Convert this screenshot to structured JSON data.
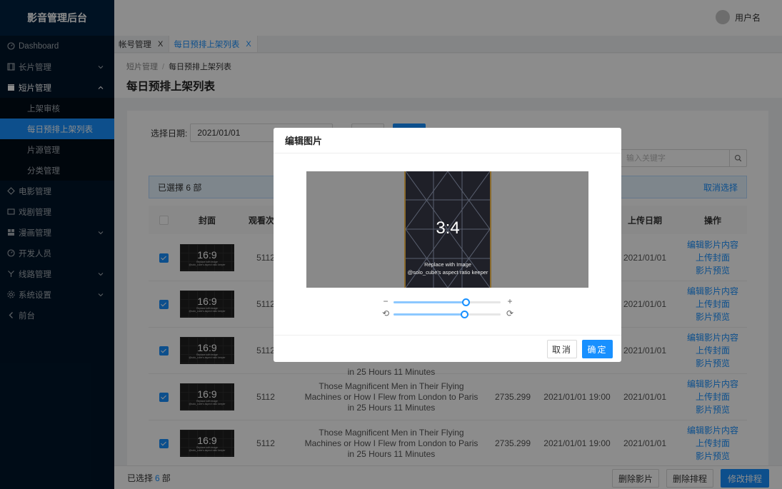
{
  "app": {
    "title": "影音管理后台"
  },
  "header": {
    "user_name": "用户名"
  },
  "sidebar": {
    "items": [
      {
        "label": "Dashboard",
        "icon": "dashboard-icon"
      },
      {
        "label": "长片管理",
        "icon": "film-icon"
      },
      {
        "label": "短片管理",
        "icon": "clapper-icon"
      },
      {
        "label": "电影管理",
        "icon": "movie-icon"
      },
      {
        "label": "戏剧管理",
        "icon": "tv-icon"
      },
      {
        "label": "漫画管理",
        "icon": "comic-icon"
      },
      {
        "label": "开发人员",
        "icon": "developer-icon"
      },
      {
        "label": "线路管理",
        "icon": "route-icon"
      },
      {
        "label": "系统设置",
        "icon": "settings-icon"
      },
      {
        "label": "前台",
        "icon": "back-icon"
      }
    ],
    "sub_items": [
      "上架审核",
      "每日预排上架列表",
      "片源管理",
      "分类管理"
    ]
  },
  "tabs": [
    {
      "label": "帐号管理",
      "close": "X"
    },
    {
      "label": "每日预排上架列表",
      "close": "X"
    }
  ],
  "breadcrumb": {
    "parent": "短片管理",
    "separator": "/",
    "current": "每日预排上架列表"
  },
  "page": {
    "title": "每日预排上架列表"
  },
  "filter": {
    "date_label": "选择日期:",
    "date_value": "2021/01/01"
  },
  "search": {
    "placeholder": "输入关键字"
  },
  "selection": {
    "text": "已選擇 6 部",
    "cancel": "取消选择"
  },
  "table": {
    "headers": {
      "cover": "封面",
      "views": "观看次数",
      "upload_date": "上传日期",
      "actions": "操作"
    },
    "rows": [
      {
        "checked": true,
        "views": "5112",
        "title": "",
        "duration": "",
        "schedule": "",
        "upload_date": "2021/01/01"
      },
      {
        "checked": true,
        "views": "5112",
        "title": "",
        "duration": "",
        "schedule": "",
        "upload_date": "2021/01/01"
      },
      {
        "checked": true,
        "views": "5112",
        "title": "in 25 Hours 11 Minutes",
        "duration": "",
        "schedule": "",
        "upload_date": "2021/01/01"
      },
      {
        "checked": true,
        "views": "5112",
        "title_lines": [
          "Those Magnificent Men in Their Flying",
          "Machines or How I Flew from London to Paris",
          "in 25 Hours 11 Minutes"
        ],
        "duration": "2735.299",
        "schedule": "2021/01/01 19:00",
        "upload_date": "2021/01/01"
      },
      {
        "checked": true,
        "views": "5112",
        "title_lines": [
          "Those Magnificent Men in Their Flying",
          "Machines or How I Flew from London to Paris",
          "in 25 Hours 11 Minutes"
        ],
        "duration": "2735.299",
        "schedule": "2021/01/01 19:00",
        "upload_date": "2021/01/01"
      }
    ],
    "thumb": {
      "ratio": "16:9",
      "line1": "Replace with Image",
      "line2": "@solo_cube's aspect ratio keeper"
    },
    "actions": [
      "编辑影片内容",
      "上传封面",
      "影片预览"
    ]
  },
  "footer": {
    "selected_prefix": "已选择",
    "selected_count": "6",
    "selected_suffix": "部",
    "buttons": [
      "删除影片",
      "删除排程",
      "修改排程"
    ]
  },
  "modal": {
    "title": "编辑图片",
    "image": {
      "ratio": "3:4",
      "line1": "Replace with Image",
      "line2": "@solo_cube's aspect ratio keeper"
    },
    "zoom": {
      "minus": "−",
      "plus": "+",
      "level": 0.67
    },
    "rotate": {
      "left": "⟲",
      "right": "⟳",
      "level": 0.66
    },
    "cancel": "取消",
    "ok": "确定"
  },
  "colors": {
    "primary": "#1890ff",
    "sidebar": "#001529",
    "mask": "rgba(0,0,0,0.45)"
  }
}
